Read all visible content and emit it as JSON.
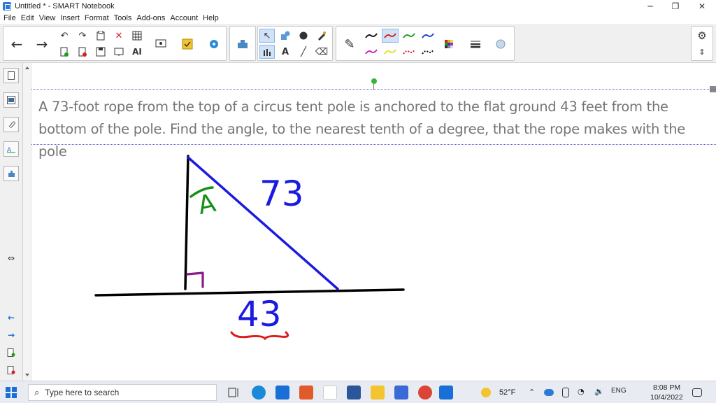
{
  "window": {
    "title": "Untitled * - SMART Notebook",
    "controls": [
      "─",
      "❐",
      "✕"
    ]
  },
  "menu": [
    "File",
    "Edit",
    "View",
    "Insert",
    "Format",
    "Tools",
    "Add-ons",
    "Account",
    "Help"
  ],
  "toolbar": {
    "back_icon": "←",
    "forward_icon": "→",
    "undo_icon": "↶",
    "redo_icon": "↷",
    "delete_icon": "✕",
    "select_icon": "↖",
    "text_icon": "A",
    "line_icon": "╱",
    "eraser_icon": "⌫",
    "pen_icon": "✎",
    "settings_icon": "⚙",
    "pen_colors": [
      "#111111",
      "#d62020",
      "#1aa01a",
      "#1a3fd6",
      "#c81ec8",
      "#e8e020",
      "#d62020",
      "#111111"
    ]
  },
  "sidebar": {
    "icons": [
      "page-sorter-icon",
      "gallery-icon",
      "attachments-icon",
      "properties-icon",
      "add-ons-icon"
    ],
    "resize_icon": "⇔",
    "nav": [
      "←",
      "→"
    ]
  },
  "problem": {
    "text": "A 73-foot rope from the top of a circus tent pole is anchored to the flat ground 43 feet from the bottom of the pole. Find the angle, to the nearest tenth of a degree, that the rope makes with the pole"
  },
  "drawing": {
    "hypotenuse_label": "73",
    "base_label": "43",
    "angle_label": "A",
    "colors": {
      "pole": "#000000",
      "ground": "#000000",
      "rope": "#1a1ae0",
      "angle": "#159015",
      "right_angle": "#8a1a8a",
      "brace": "#e01a1a"
    }
  },
  "taskbar": {
    "search_placeholder": "Type here to search",
    "weather": "52°F",
    "time": "8:08 PM",
    "date": "10/4/2022"
  }
}
